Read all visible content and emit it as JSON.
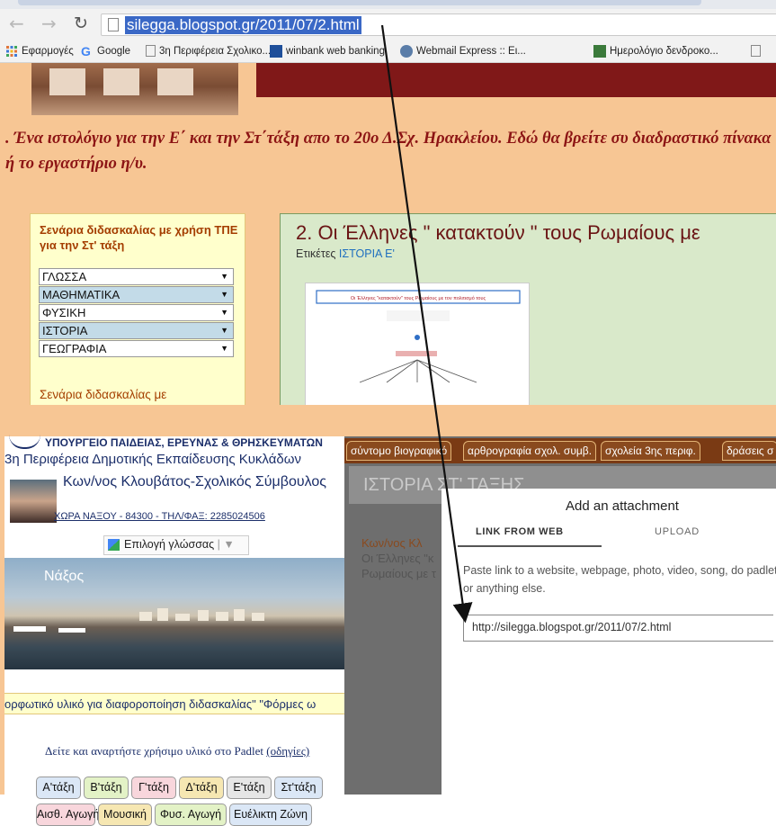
{
  "browser": {
    "url": "silegga.blogspot.gr/2011/07/2.html",
    "bookmarks": [
      {
        "label": "Εφαρμογές",
        "icon": "apps-grid-icon"
      },
      {
        "label": "Google",
        "icon": "google-g-icon"
      },
      {
        "label": "3η Περιφέρεια Σχολικο...",
        "icon": "page-icon"
      },
      {
        "label": "winbank web banking",
        "icon": "winbank-icon"
      },
      {
        "label": "Webmail Express :: Ει...",
        "icon": "webmail-icon"
      },
      {
        "label": "Ημερολόγιο δενδροκο...",
        "icon": "calendar-icon"
      }
    ]
  },
  "blog": {
    "tagline": ". Ένα ιστολόγιο για την Ε΄ και την Στ΄τάξη απο το 20ο Δ.Σχ. Ηρακλείου. Εδώ θα βρείτε συ διαδραστικό πίνακα ή το εργαστήριο η/υ.",
    "sidebar_title": "Σενάρια διδασκαλίας με χρήση ΤΠΕ για την Στ' τάξη",
    "subjects": [
      "ΓΛΩΣΣΑ",
      "ΜΑΘΗΜΑΤΙΚΑ",
      "ΦΥΣΙΚΗ",
      "ΙΣΤΟΡΙΑ",
      "ΓΕΩΓΡΑΦΙΑ"
    ],
    "sidebar_footer": "Σενάρια διδασκαλίας με",
    "post_title": "2. Οι Έλληνες \" κατακτούν \" τους Ρωμαίους με",
    "tags_label": "Ετικέτες",
    "tag": "ΙΣΤΟΡΙΑ Ε'",
    "diagram_heading": "Οι Έλληνες \"κατακτούν\" τους Ρωμαίους με τον πολιτισμό τους"
  },
  "site2": {
    "ministry": "ΥΠΟΥΡΓΕΙΟ ΠΑΙΔΕΙΑΣ, ΕΡΕΥΝΑΣ & ΘΡΗΣΚΕΥΜΑΤΩΝ",
    "region": "3η Περιφέρεια Δημοτικής Εκπαίδευσης Κυκλάδων",
    "person": "Κων/νος Κλουβάτος-Σχολικός Σύμβουλος",
    "contact": "ΧΩΡΑ ΝΑΞΟΥ - 84300 - ΤΗΛ/ΦΑΞ: 2285024506",
    "language_button": "Επιλογή γλώσσας",
    "photo_label": "Νάξος",
    "marquee": "ορφωτικό υλικό για  διαφοροποίηση διδασκαλίας\"   \"Φόρμες ω",
    "padlet_text": "Δείτε και αναρτήστε χρήσιμο υλικό στο Padlet",
    "padlet_link": "(οδηγίες)",
    "grade_buttons": [
      {
        "label": "Α'τάξη",
        "color": "#dbe7f6"
      },
      {
        "label": "Β'τάξη",
        "color": "#e3f2c6"
      },
      {
        "label": "Γ'τάξη",
        "color": "#f8d6dc"
      },
      {
        "label": "Δ'τάξη",
        "color": "#f6e7b2"
      },
      {
        "label": "Ε'τάξη",
        "color": "#e6e6e6"
      },
      {
        "label": "Στ'τάξη",
        "color": "#dbe7f6"
      }
    ],
    "subject_buttons": [
      {
        "label": "Αισθ. Αγωγή",
        "color": "#f8d6dc"
      },
      {
        "label": "Μουσική",
        "color": "#f6e7b2"
      },
      {
        "label": "Φυσ. Αγωγή",
        "color": "#e3f2c6"
      },
      {
        "label": "Ευέλικτη Ζώνη",
        "color": "#dbe7f6"
      }
    ],
    "nav": [
      "σύντομο βιογραφικό",
      "αρθρογραφία σχολ. συμβ.",
      "σχολεία 3ης περιφ.",
      "δράσεις σ"
    ],
    "dimmed_title": "ΙΣΤΟΡΙΑ ΣΤ' ΤΑΞΗΣ",
    "dimmed_lines": [
      "Κων/νος Κλ",
      "Οι Έλληνες \"κ",
      "Ρωμαίους με τ"
    ]
  },
  "modal": {
    "title": "Add an attachment",
    "tab_link": "LINK FROM WEB",
    "tab_upload": "UPLOAD",
    "description": "Paste link to a website, webpage, photo, video, song, do padlet, or anything else.",
    "input_value": "http://silegga.blogspot.gr/2011/07/2.html"
  },
  "colors": {
    "background": "#f7c694",
    "blog_red": "#8c1414",
    "link_blue": "#1f6fbf"
  }
}
